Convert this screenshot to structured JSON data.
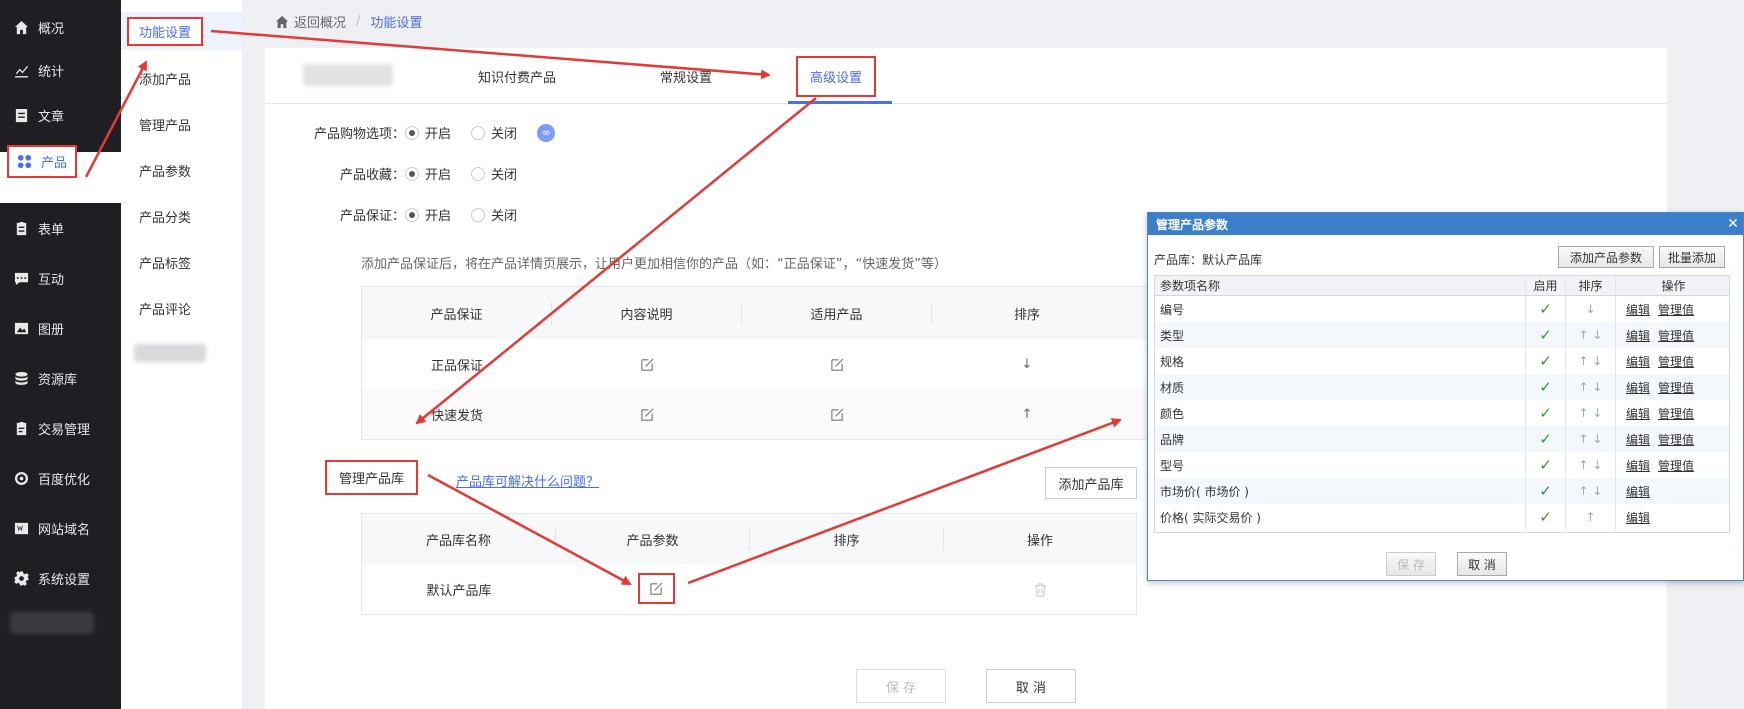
{
  "sidebar": {
    "items": [
      {
        "label": "概况",
        "icon": "home-icon"
      },
      {
        "label": "统计",
        "icon": "chart-icon"
      },
      {
        "label": "文章",
        "icon": "document-icon"
      },
      {
        "label": "产品",
        "icon": "grid-icon"
      },
      {
        "label": "表单",
        "icon": "clipboard-icon"
      },
      {
        "label": "互动",
        "icon": "chat-icon"
      },
      {
        "label": "图册",
        "icon": "image-icon"
      },
      {
        "label": "资源库",
        "icon": "database-icon"
      },
      {
        "label": "交易管理",
        "icon": "order-icon"
      },
      {
        "label": "百度优化",
        "icon": "target-icon"
      },
      {
        "label": "网站域名",
        "icon": "website-icon"
      },
      {
        "label": "系统设置",
        "icon": "gear-icon"
      }
    ]
  },
  "submenu": {
    "items": [
      "功能设置",
      "添加产品",
      "管理产品",
      "产品参数",
      "产品分类",
      "产品标签",
      "产品评论"
    ]
  },
  "breadcrumb": {
    "back": "返回概况",
    "separator": "/",
    "current": "功能设置"
  },
  "tabs": {
    "items": [
      "知识付费产品",
      "常规设置",
      "高级设置"
    ]
  },
  "form": {
    "rows": [
      {
        "label": "产品购物选项：",
        "on": "开启",
        "off": "关闭"
      },
      {
        "label": "产品收藏：",
        "on": "开启",
        "off": "关闭"
      },
      {
        "label": "产品保证：",
        "on": "开启",
        "off": "关闭"
      }
    ],
    "hint": "添加产品保证后，将在产品详情页展示，让用户更加相信你的产品（如：“正品保证”，“快速发货”等）"
  },
  "guarantee_table": {
    "headers": [
      "产品保证",
      "内容说明",
      "适用产品",
      "排序"
    ],
    "rows": [
      {
        "name": "正品保证",
        "sort": "↓"
      },
      {
        "name": "快速发货",
        "sort": "↑"
      }
    ]
  },
  "library": {
    "label": "管理产品库",
    "help_link": "产品库可解决什么问题？",
    "add_button": "添加产品库",
    "headers": [
      "产品库名称",
      "产品参数",
      "排序",
      "操作"
    ],
    "rows": [
      {
        "name": "默认产品库"
      }
    ]
  },
  "footer": {
    "save": "保 存",
    "cancel": "取 消"
  },
  "dialog": {
    "title": "管理产品参数",
    "close": "✕",
    "library": "产品库：默认产品库",
    "add_param": "添加产品参数",
    "batch_add": "批量添加",
    "headers": {
      "name": "参数项名称",
      "enabled": "启用",
      "sort": "排序",
      "ops": "操作"
    },
    "rows": [
      {
        "name": "编号",
        "edit": "编辑",
        "manage": "管理值"
      },
      {
        "name": "类型",
        "edit": "编辑",
        "manage": "管理值"
      },
      {
        "name": "规格",
        "edit": "编辑",
        "manage": "管理值"
      },
      {
        "name": "材质",
        "edit": "编辑",
        "manage": "管理值"
      },
      {
        "name": "颜色",
        "edit": "编辑",
        "manage": "管理值"
      },
      {
        "name": "品牌",
        "edit": "编辑",
        "manage": "管理值"
      },
      {
        "name": "型号",
        "edit": "编辑",
        "manage": "管理值"
      },
      {
        "name": "市场价( 市场价 )",
        "edit": "编辑",
        "manage": ""
      },
      {
        "name": "价格( 实际交易价 )",
        "edit": "编辑",
        "manage": ""
      }
    ],
    "save": "保 存",
    "cancel": "取 消"
  },
  "colors": {
    "accent": "#4a6cf7",
    "highlight": "#e53935",
    "sidebar": "#1f1f23",
    "dialog_header": "#3b7fc9",
    "check": "#2e9a2e"
  }
}
